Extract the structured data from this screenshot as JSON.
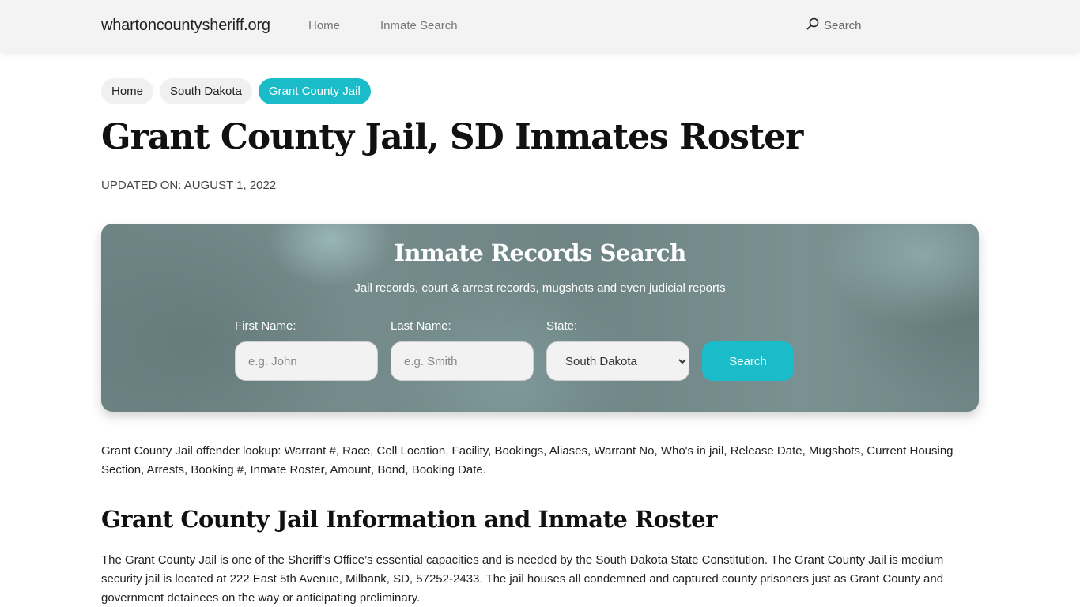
{
  "navbar": {
    "brand": "whartoncountysheriff.org",
    "links": [
      "Home",
      "Inmate Search"
    ],
    "search_label": "Search"
  },
  "breadcrumb": {
    "items": [
      {
        "label": "Home",
        "active": false
      },
      {
        "label": "South Dakota",
        "active": false
      },
      {
        "label": "Grant County Jail",
        "active": true
      }
    ]
  },
  "page": {
    "title": "Grant County Jail, SD Inmates Roster",
    "updated": "UPDATED ON: AUGUST 1, 2022"
  },
  "search_panel": {
    "title": "Inmate Records Search",
    "subtitle": "Jail records, court & arrest records, mugshots and even judicial reports",
    "first_name": {
      "label": "First Name:",
      "placeholder": "e.g. John",
      "value": ""
    },
    "last_name": {
      "label": "Last Name:",
      "placeholder": "e.g. Smith",
      "value": ""
    },
    "state": {
      "label": "State:",
      "selected": "South Dakota"
    },
    "button_label": "Search"
  },
  "content": {
    "intro": "Grant County Jail offender lookup: Warrant #, Race, Cell Location, Facility, Bookings, Aliases, Warrant No, Who's in jail, Release Date, Mugshots, Current Housing Section, Arrests, Booking #, Inmate Roster, Amount, Bond, Booking Date.",
    "section_title": "Grant County Jail Information and Inmate Roster",
    "body": "The Grant County Jail is one of the Sheriff’s Office’s essential capacities and is needed by the South Dakota State Constitution. The Grant County Jail is medium security jail is located at 222 East 5th Avenue, Milbank, SD, 57252-2433. The jail houses all condemned and captured county prisoners just as Grant County and government detainees on the way or anticipating preliminary."
  },
  "colors": {
    "accent": "#1bbcc9",
    "navbar_bg": "#f3f3f3",
    "panel_bg": "#728889"
  }
}
